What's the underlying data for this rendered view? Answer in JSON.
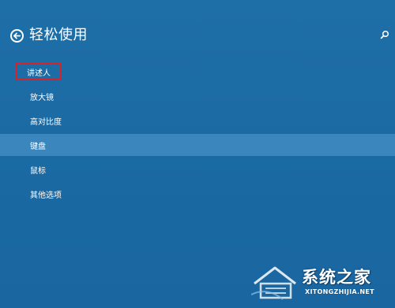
{
  "header": {
    "title": "轻松使用"
  },
  "menu": {
    "items": [
      {
        "label": "讲述人"
      },
      {
        "label": "放大镜"
      },
      {
        "label": "高对比度"
      },
      {
        "label": "键盘"
      },
      {
        "label": "鼠标"
      },
      {
        "label": "其他选项"
      }
    ],
    "selected_item": "键盘",
    "highlighted_item": "讲述人"
  },
  "watermark": {
    "text": "系统之家",
    "domain": "XITONGZHIJIA.NET"
  },
  "icons": {
    "back": "arrow-left-circle-icon",
    "search": "search-icon"
  },
  "colors": {
    "background": "#1d6ca5",
    "selected": "#3b86bd",
    "highlight_border": "#d8222a"
  }
}
